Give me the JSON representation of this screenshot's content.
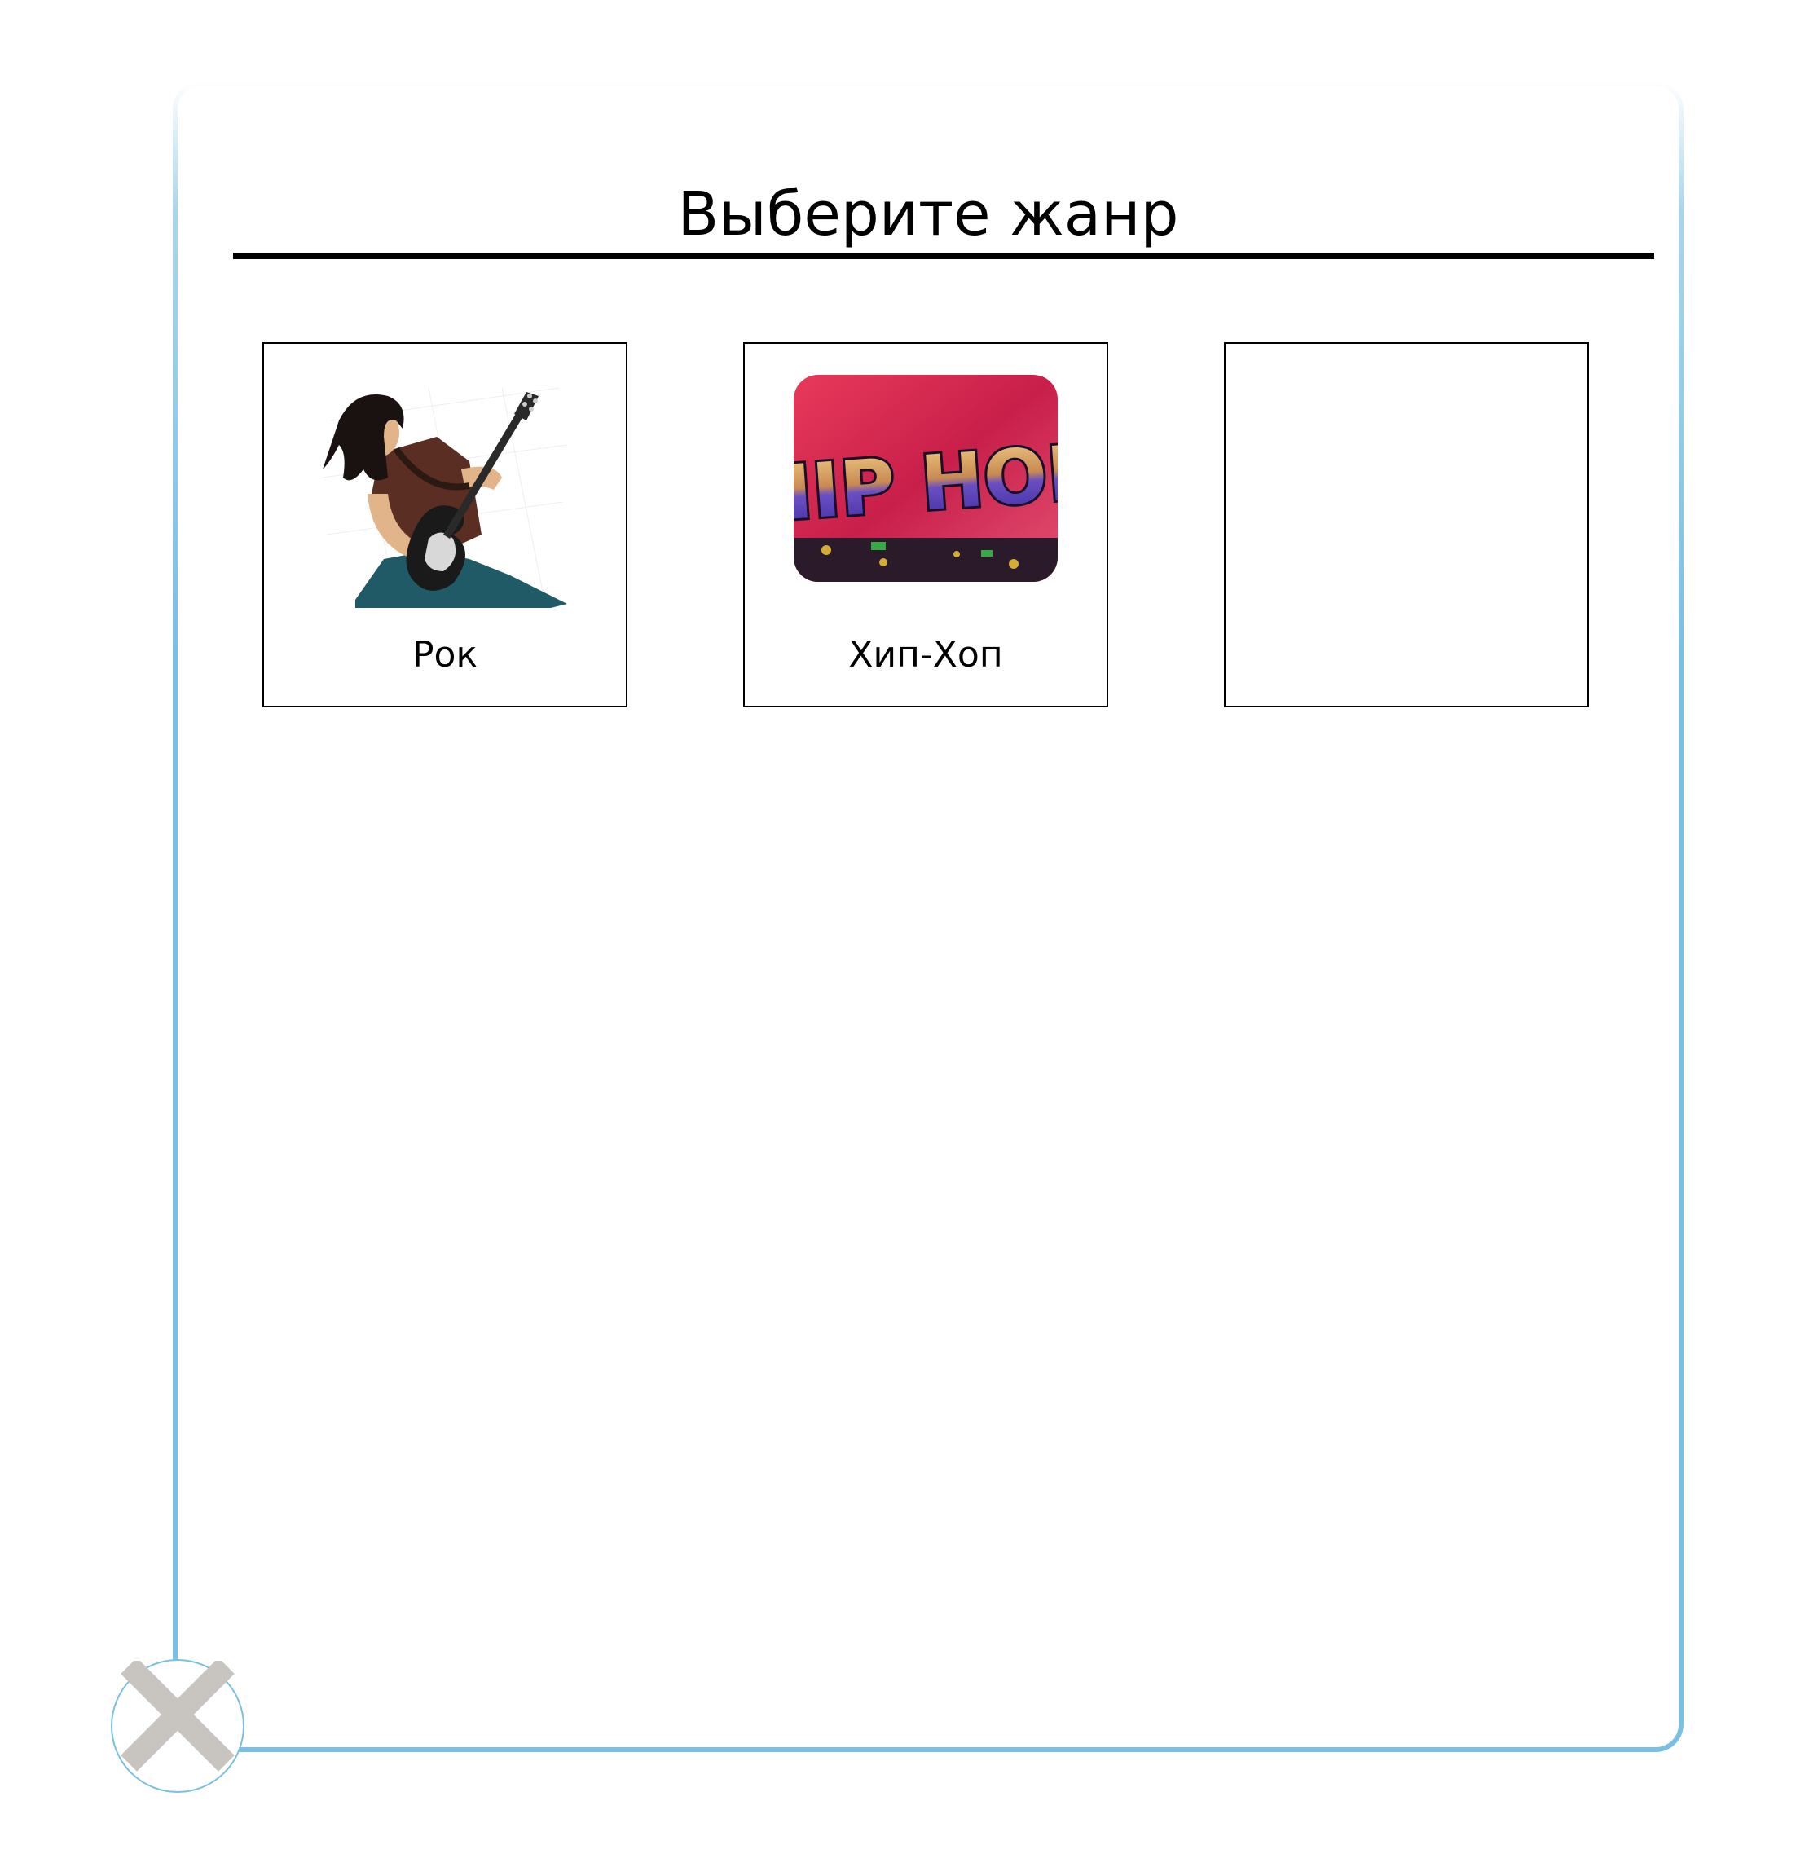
{
  "dialog": {
    "title": "Выберите жанр",
    "accent_color": "#7bbfe2"
  },
  "genres": [
    {
      "label": "Рок",
      "icon": "rock-guitarist-icon"
    },
    {
      "label": "Хип-Хоп",
      "icon": "hip-hop-graffiti-icon",
      "image_text": "HIP HOP"
    },
    {
      "label": "",
      "icon": ""
    }
  ],
  "close_button": {
    "icon": "close-icon",
    "color": "#c8c4c0"
  }
}
